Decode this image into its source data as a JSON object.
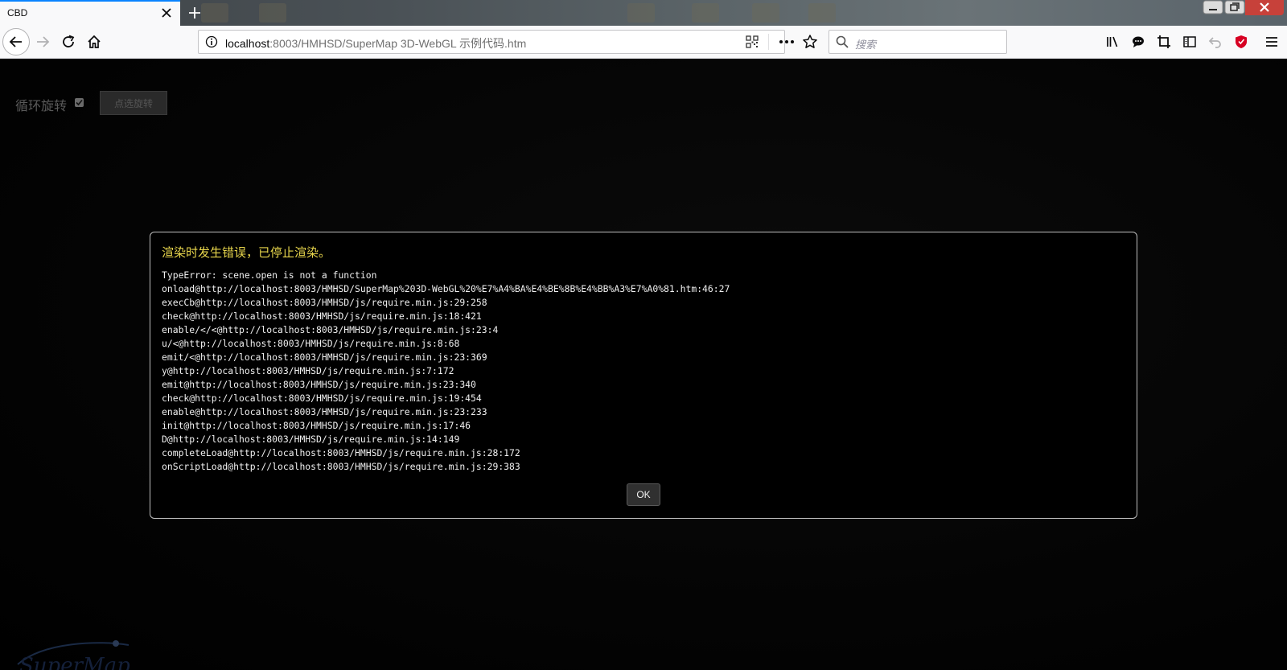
{
  "tab": {
    "title": "CBD"
  },
  "navbar": {
    "url_host": "localhost",
    "url_rest": ":8003/HMHSD/SuperMap 3D-WebGL 示例代码.htm",
    "search_placeholder": "搜索"
  },
  "page": {
    "rotate_label": "循环旋转",
    "rotate_checked": true,
    "select_rotate_button": "点选旋转"
  },
  "dialog": {
    "title": "渲染时发生错误，已停止渲染。",
    "lines": [
      "TypeError: scene.open is not a function",
      "onload@http://localhost:8003/HMHSD/SuperMap%203D-WebGL%20%E7%A4%BA%E4%BE%8B%E4%BB%A3%E7%A0%81.htm:46:27",
      "execCb@http://localhost:8003/HMHSD/js/require.min.js:29:258",
      "check@http://localhost:8003/HMHSD/js/require.min.js:18:421",
      "enable/</<@http://localhost:8003/HMHSD/js/require.min.js:23:4",
      "u/<@http://localhost:8003/HMHSD/js/require.min.js:8:68",
      "emit/<@http://localhost:8003/HMHSD/js/require.min.js:23:369",
      "y@http://localhost:8003/HMHSD/js/require.min.js:7:172",
      "emit@http://localhost:8003/HMHSD/js/require.min.js:23:340",
      "check@http://localhost:8003/HMHSD/js/require.min.js:19:454",
      "enable@http://localhost:8003/HMHSD/js/require.min.js:23:233",
      "init@http://localhost:8003/HMHSD/js/require.min.js:17:46",
      "D@http://localhost:8003/HMHSD/js/require.min.js:14:149",
      "completeLoad@http://localhost:8003/HMHSD/js/require.min.js:28:172",
      "onScriptLoad@http://localhost:8003/HMHSD/js/require.min.js:29:383"
    ],
    "ok_label": "OK"
  },
  "colors": {
    "dialog_title": "#e8d64c",
    "tab_accent": "#0a84ff",
    "window_close": "#c7413a"
  },
  "icons": [
    "close-icon",
    "plus-icon",
    "back-arrow-icon",
    "forward-arrow-icon",
    "reload-icon",
    "home-icon",
    "info-icon",
    "qr-code-icon",
    "more-dots-icon",
    "star-icon",
    "search-icon",
    "library-icon",
    "chat-icon",
    "crop-icon",
    "sidebar-icon",
    "undo-icon",
    "shield-icon",
    "hamburger-menu-icon",
    "checkmark-icon",
    "supermap-logo"
  ]
}
